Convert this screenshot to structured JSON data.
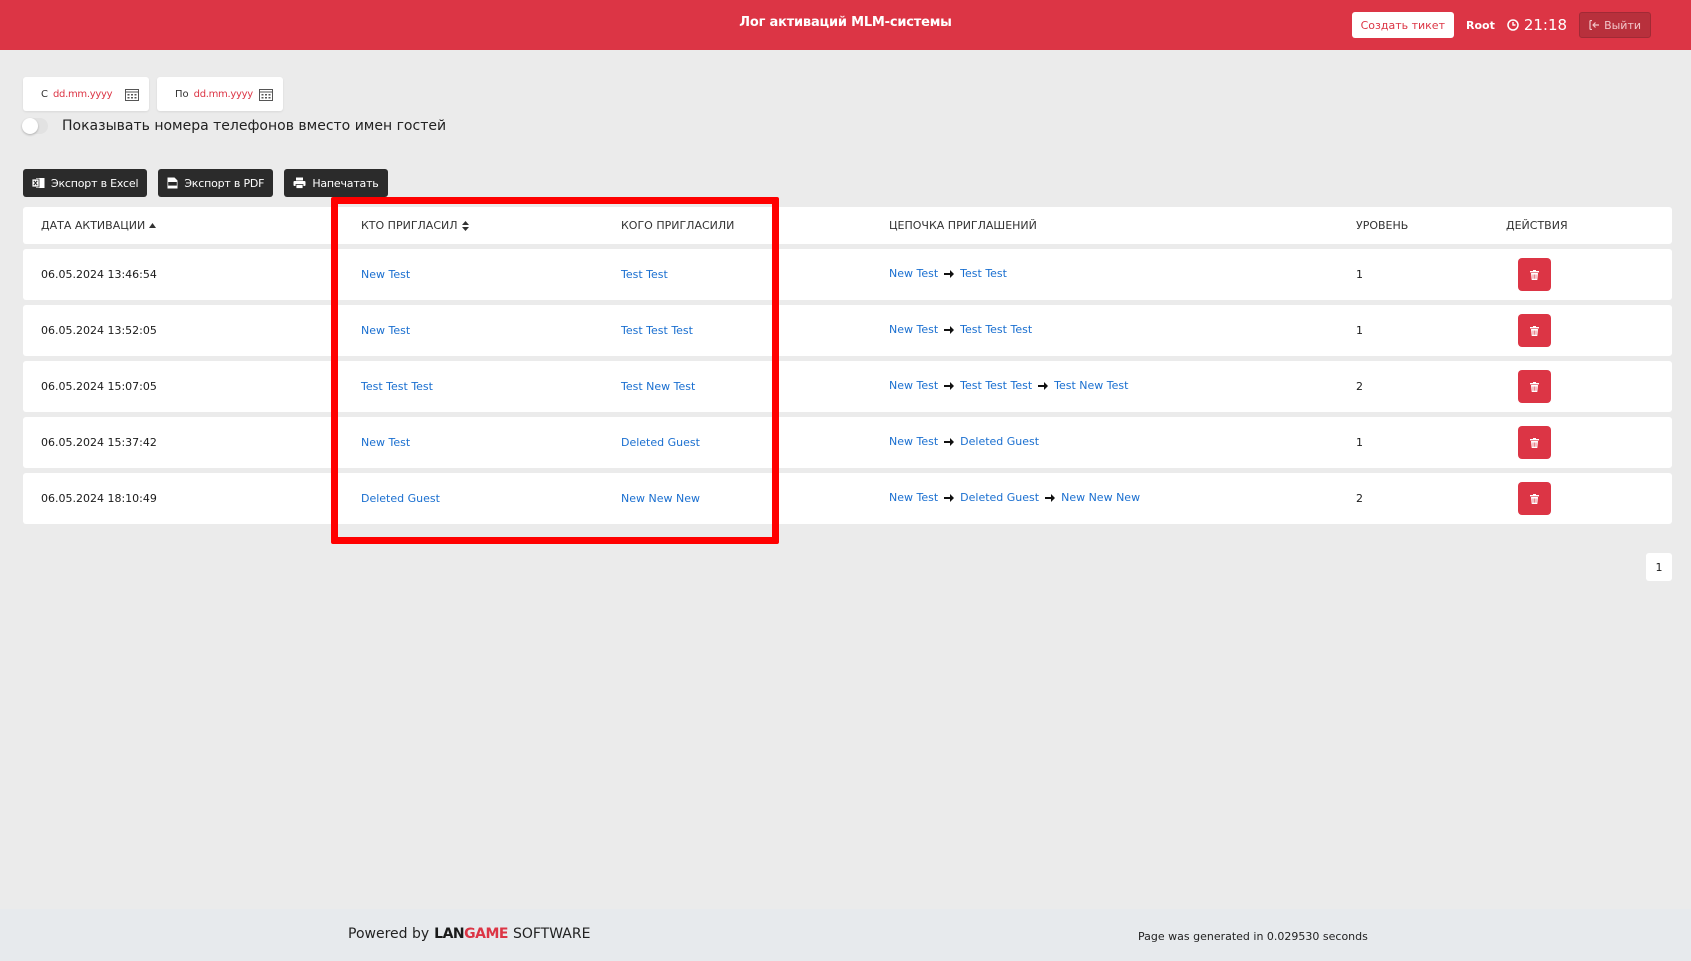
{
  "header": {
    "title": "Лог активаций MLM-системы",
    "create_ticket": "Создать тикет",
    "user": "Root",
    "time": "21:18",
    "logout": "Выйти"
  },
  "filters": {
    "from_label": "С",
    "from_value": "dd.mm.yyyy",
    "to_label": "По",
    "to_value": "dd.mm.yyyy",
    "toggle_label": "Показывать номера телефонов вместо имен гостей"
  },
  "toolbar": {
    "export_excel": "Экспорт в Excel",
    "export_pdf": "Экспорт в PDF",
    "print": "Напечатать"
  },
  "table": {
    "headers": {
      "date": "ДАТА АКТИВАЦИИ",
      "who": "КТО ПРИГЛАСИЛ",
      "whom": "КОГО ПРИГЛАСИЛИ",
      "chain": "ЦЕПОЧКА ПРИГЛАШЕНИЙ",
      "level": "УРОВЕНЬ",
      "actions": "ДЕЙСТВИЯ"
    },
    "rows": [
      {
        "date": "06.05.2024 13:46:54",
        "who": "New Test",
        "whom": "Test Test",
        "chain": [
          "New Test",
          "Test Test"
        ],
        "level": "1"
      },
      {
        "date": "06.05.2024 13:52:05",
        "who": "New Test",
        "whom": "Test Test Test",
        "chain": [
          "New Test",
          "Test Test Test"
        ],
        "level": "1"
      },
      {
        "date": "06.05.2024 15:07:05",
        "who": "Test Test Test",
        "whom": "Test New Test",
        "chain": [
          "New Test",
          "Test Test Test",
          "Test New Test"
        ],
        "level": "2"
      },
      {
        "date": "06.05.2024 15:37:42",
        "who": "New Test",
        "whom": "Deleted Guest",
        "chain": [
          "New Test",
          "Deleted Guest"
        ],
        "level": "1"
      },
      {
        "date": "06.05.2024 18:10:49",
        "who": "Deleted Guest",
        "whom": "New New New",
        "chain": [
          "New Test",
          "Deleted Guest",
          "New New New"
        ],
        "level": "2"
      }
    ]
  },
  "pagination": {
    "current": "1"
  },
  "footer": {
    "powered_by": "Powered by",
    "brand_lan": "LAN",
    "brand_game": "GAME",
    "brand_software": "SOFTWARE",
    "generated": "Page was generated in 0.029530 seconds"
  }
}
